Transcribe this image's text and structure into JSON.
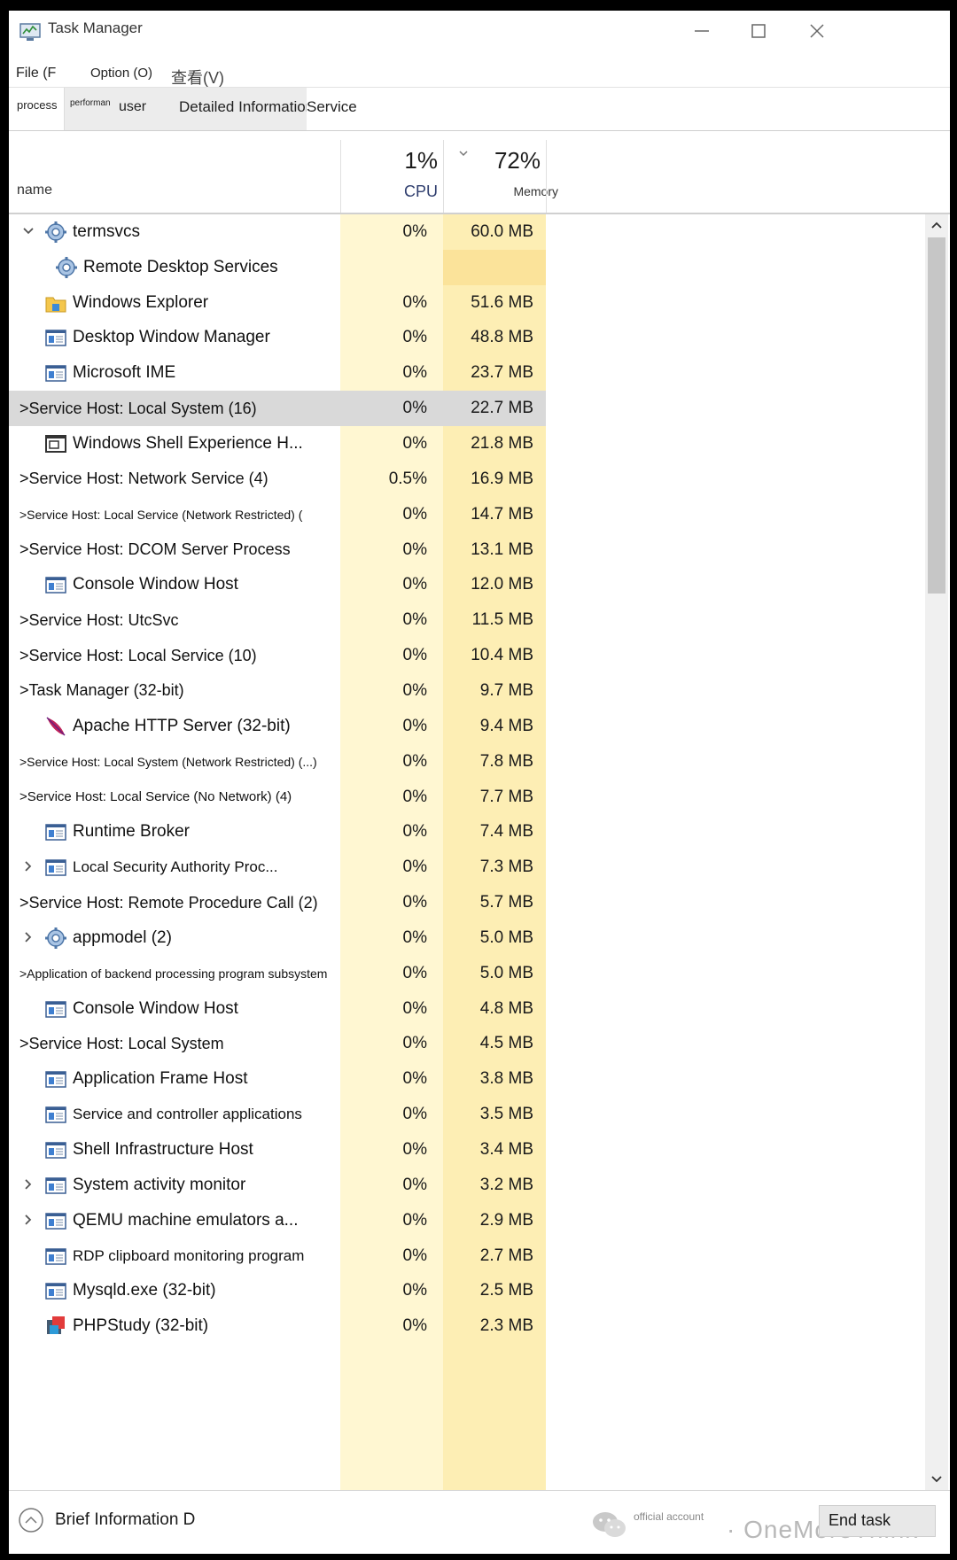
{
  "window": {
    "title": "Task Manager"
  },
  "menu": {
    "file": "File (F",
    "option": "Option (O)",
    "view": "查看(V)"
  },
  "tabs": {
    "process": "process",
    "performance": "performance",
    "user": "user",
    "detail": "Detailed Information",
    "service": "Service"
  },
  "columns": {
    "name": "name",
    "cpu_percent": "1%",
    "cpu_label": "CPU",
    "memory_percent": "72%",
    "memory_label": "Memory"
  },
  "rows": [
    {
      "name": "termsvcs",
      "cpu": "0%",
      "mem": "60.0 MB",
      "icon": "gear-icon",
      "expander": "expanded"
    },
    {
      "name": "Remote Desktop Services",
      "cpu": "",
      "mem": "",
      "icon": "gear-icon",
      "expander": "none"
    },
    {
      "name": "Windows Explorer",
      "cpu": "0%",
      "mem": "51.6 MB",
      "icon": "folder-icon",
      "expander": "none"
    },
    {
      "name": "Desktop Window Manager",
      "cpu": "0%",
      "mem": "48.8 MB",
      "icon": "app-window-icon",
      "expander": "none"
    },
    {
      "name": "Microsoft IME",
      "cpu": "0%",
      "mem": "23.7 MB",
      "icon": "app-window-icon",
      "expander": "none"
    },
    {
      "name": ">Service Host: Local System (16)",
      "cpu": "0%",
      "mem": "22.7 MB",
      "icon": "",
      "expander": "none"
    },
    {
      "name": "Windows Shell Experience H...",
      "cpu": "0%",
      "mem": "21.8 MB",
      "icon": "shell-window-icon",
      "expander": "none"
    },
    {
      "name": ">Service Host: Network Service (4)",
      "cpu": "0.5%",
      "mem": "16.9 MB",
      "icon": "",
      "expander": "none"
    },
    {
      "name": ">Service Host: Local Service (Network Restricted)  (",
      "cpu": "0%",
      "mem": "14.7 MB",
      "icon": "",
      "expander": "none"
    },
    {
      "name": ">Service Host: DCOM Server Process",
      "cpu": "0%",
      "mem": "13.1 MB",
      "icon": "",
      "expander": "none"
    },
    {
      "name": "Console Window Host",
      "cpu": "0%",
      "mem": "12.0 MB",
      "icon": "app-window-icon",
      "expander": "none"
    },
    {
      "name": ">Service Host: UtcSvc",
      "cpu": "0%",
      "mem": "11.5 MB",
      "icon": "",
      "expander": "none"
    },
    {
      "name": ">Service Host: Local Service (10)",
      "cpu": "0%",
      "mem": "10.4 MB",
      "icon": "",
      "expander": "none"
    },
    {
      "name": ">Task Manager (32-bit)",
      "cpu": "0%",
      "mem": "9.7 MB",
      "icon": "",
      "expander": "none"
    },
    {
      "name": "Apache HTTP Server (32-bit)",
      "cpu": "0%",
      "mem": "9.4 MB",
      "icon": "feather-icon",
      "expander": "none"
    },
    {
      "name": ">Service Host: Local System (Network Restricted) (...)",
      "cpu": "0%",
      "mem": "7.8 MB",
      "icon": "",
      "expander": "none"
    },
    {
      "name": ">Service Host: Local Service (No Network) (4)",
      "cpu": "0%",
      "mem": "7.7 MB",
      "icon": "",
      "expander": "none"
    },
    {
      "name": "Runtime Broker",
      "cpu": "0%",
      "mem": "7.4 MB",
      "icon": "app-window-icon",
      "expander": "none"
    },
    {
      "name": "Local Security Authority Proc...",
      "cpu": "0%",
      "mem": "7.3 MB",
      "icon": "app-window-icon",
      "expander": "collapsed"
    },
    {
      "name": ">Service Host: Remote Procedure Call (2)",
      "cpu": "0%",
      "mem": "5.7 MB",
      "icon": "",
      "expander": "none"
    },
    {
      "name": "appmodel (2)",
      "cpu": "0%",
      "mem": "5.0 MB",
      "icon": "gear-icon",
      "expander": "collapsed"
    },
    {
      "name": ">Application of backend processing program subsystem",
      "cpu": "0%",
      "mem": "5.0 MB",
      "icon": "",
      "expander": "none"
    },
    {
      "name": "Console Window Host",
      "cpu": "0%",
      "mem": "4.8 MB",
      "icon": "app-window-icon",
      "expander": "none"
    },
    {
      "name": ">Service Host: Local System",
      "cpu": "0%",
      "mem": "4.5 MB",
      "icon": "",
      "expander": "none"
    },
    {
      "name": "Application Frame Host",
      "cpu": "0%",
      "mem": "3.8 MB",
      "icon": "app-window-icon",
      "expander": "none"
    },
    {
      "name": "Service and controller applications",
      "cpu": "0%",
      "mem": "3.5 MB",
      "icon": "app-window-icon",
      "expander": "none"
    },
    {
      "name": "Shell Infrastructure Host",
      "cpu": "0%",
      "mem": "3.4 MB",
      "icon": "app-window-icon",
      "expander": "none"
    },
    {
      "name": "System activity monitor",
      "cpu": "0%",
      "mem": "3.2 MB",
      "icon": "app-window-icon",
      "expander": "collapsed"
    },
    {
      "name": "QEMU machine emulators a...",
      "cpu": "0%",
      "mem": "2.9 MB",
      "icon": "app-window-icon",
      "expander": "collapsed"
    },
    {
      "name": "RDP clipboard monitoring program",
      "cpu": "0%",
      "mem": "2.7 MB",
      "icon": "app-window-icon",
      "expander": "none"
    },
    {
      "name": "Mysqld.exe (32-bit)",
      "cpu": "0%",
      "mem": "2.5 MB",
      "icon": "app-window-icon",
      "expander": "none"
    },
    {
      "name": "PHPStudy (32-bit)",
      "cpu": "0%",
      "mem": "2.3 MB",
      "icon": "phpstudy-icon",
      "expander": "none"
    }
  ],
  "footer": {
    "brief": "Brief Information D",
    "watermark_account": "official account",
    "watermark_brand": "· OneMoreThink",
    "end_task": "End task"
  },
  "colors": {
    "cpu_bg": "#fff7d2",
    "mem_bg": "#fdeeb4",
    "selected_row": "#d9d9d9"
  }
}
